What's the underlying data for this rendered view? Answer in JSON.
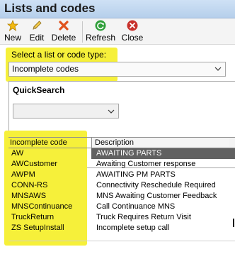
{
  "window": {
    "title": "Lists and codes"
  },
  "toolbar": {
    "buttons": [
      {
        "label": "New",
        "icon": "star-icon"
      },
      {
        "label": "Edit",
        "icon": "pencil-icon"
      },
      {
        "label": "Delete",
        "icon": "delete-x-icon"
      },
      {
        "label": "Refresh",
        "icon": "refresh-icon"
      },
      {
        "label": "Close",
        "icon": "close-icon"
      }
    ]
  },
  "selector": {
    "label": "Select a list or code type:",
    "value": "Incomplete codes"
  },
  "quicksearch": {
    "title": "QuickSearch",
    "value": ""
  },
  "grid": {
    "columns": [
      "Incomplete code",
      "Description"
    ],
    "rows": [
      {
        "code": "AW",
        "description": "AWAITING PARTS",
        "selected": true
      },
      {
        "code": "AWCustomer",
        "description": "Awaiting Customer response"
      },
      {
        "code": "AWPM",
        "description": "AWAITING PM PARTS"
      },
      {
        "code": "CONN-RS",
        "description": "Connectivity Reschedule Required"
      },
      {
        "code": "MNSAWS",
        "description": "MNS Awaiting Customer Feedback"
      },
      {
        "code": "MNSContinuance",
        "description": "Call Continuance MNS"
      },
      {
        "code": "TruckReturn",
        "description": "Truck Requires Return Visit"
      },
      {
        "code": "ZS SetupInstall",
        "description": "Incomplete setup call"
      }
    ]
  },
  "colors": {
    "highlight": "#f6f03a",
    "selected_row": "#616161",
    "titlebar": "#c3d8f0"
  }
}
